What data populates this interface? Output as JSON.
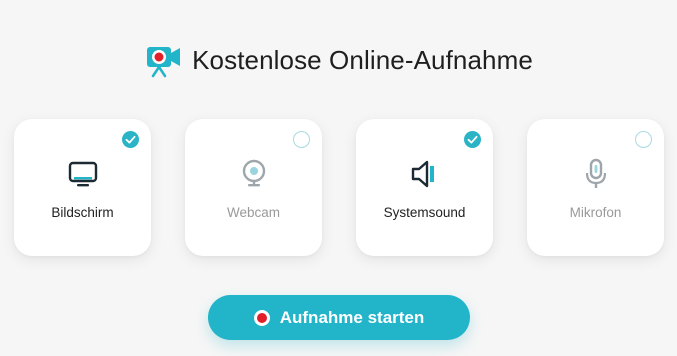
{
  "header": {
    "title": "Kostenlose Online-Aufnahme",
    "logo_icon": "camera-recorder-icon"
  },
  "options": [
    {
      "label": "Bildschirm",
      "icon": "monitor-icon",
      "checked": true
    },
    {
      "label": "Webcam",
      "icon": "webcam-icon",
      "checked": false
    },
    {
      "label": "Systemsound",
      "icon": "speaker-icon",
      "checked": true
    },
    {
      "label": "Mikrofon",
      "icon": "microphone-icon",
      "checked": false
    }
  ],
  "start_button": {
    "label": "Aufnahme starten",
    "icon": "record-dot-icon"
  },
  "colors": {
    "accent": "#22b4c8",
    "record_red": "#e2202c",
    "text_active": "#222222",
    "text_inactive": "#9a9a9a"
  }
}
